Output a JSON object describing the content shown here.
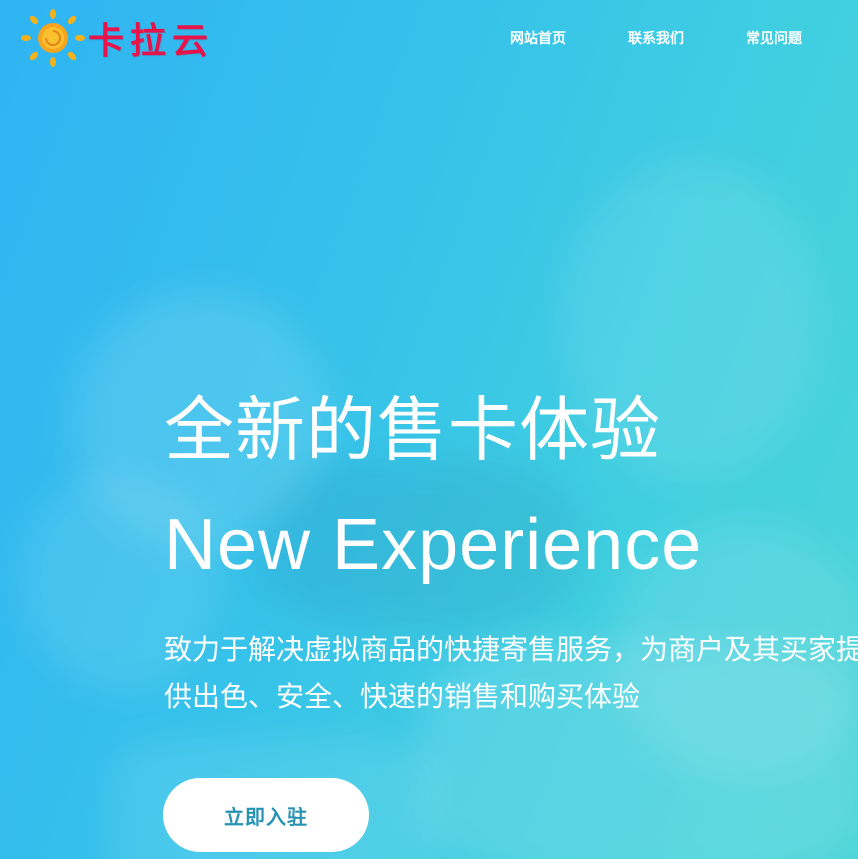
{
  "brand": {
    "logo_text": "卡拉云",
    "logo_icon": "sun-icon",
    "logo_color": "#e8134a"
  },
  "nav": {
    "items": [
      {
        "label": "网站首页"
      },
      {
        "label": "联系我们"
      },
      {
        "label": "常见问题"
      }
    ]
  },
  "hero": {
    "title": "全新的售卡体验",
    "subtitle": "New Experience",
    "description": "致力于解决虚拟商品的快捷寄售服务，为商户及其买家提供出色、安全、快速的销售和购买体验",
    "cta_label": "立即入驻",
    "cta_color": "#2793b4"
  },
  "theme": {
    "background_start": "#2fb4f3",
    "background_end": "#4dd5d8"
  }
}
